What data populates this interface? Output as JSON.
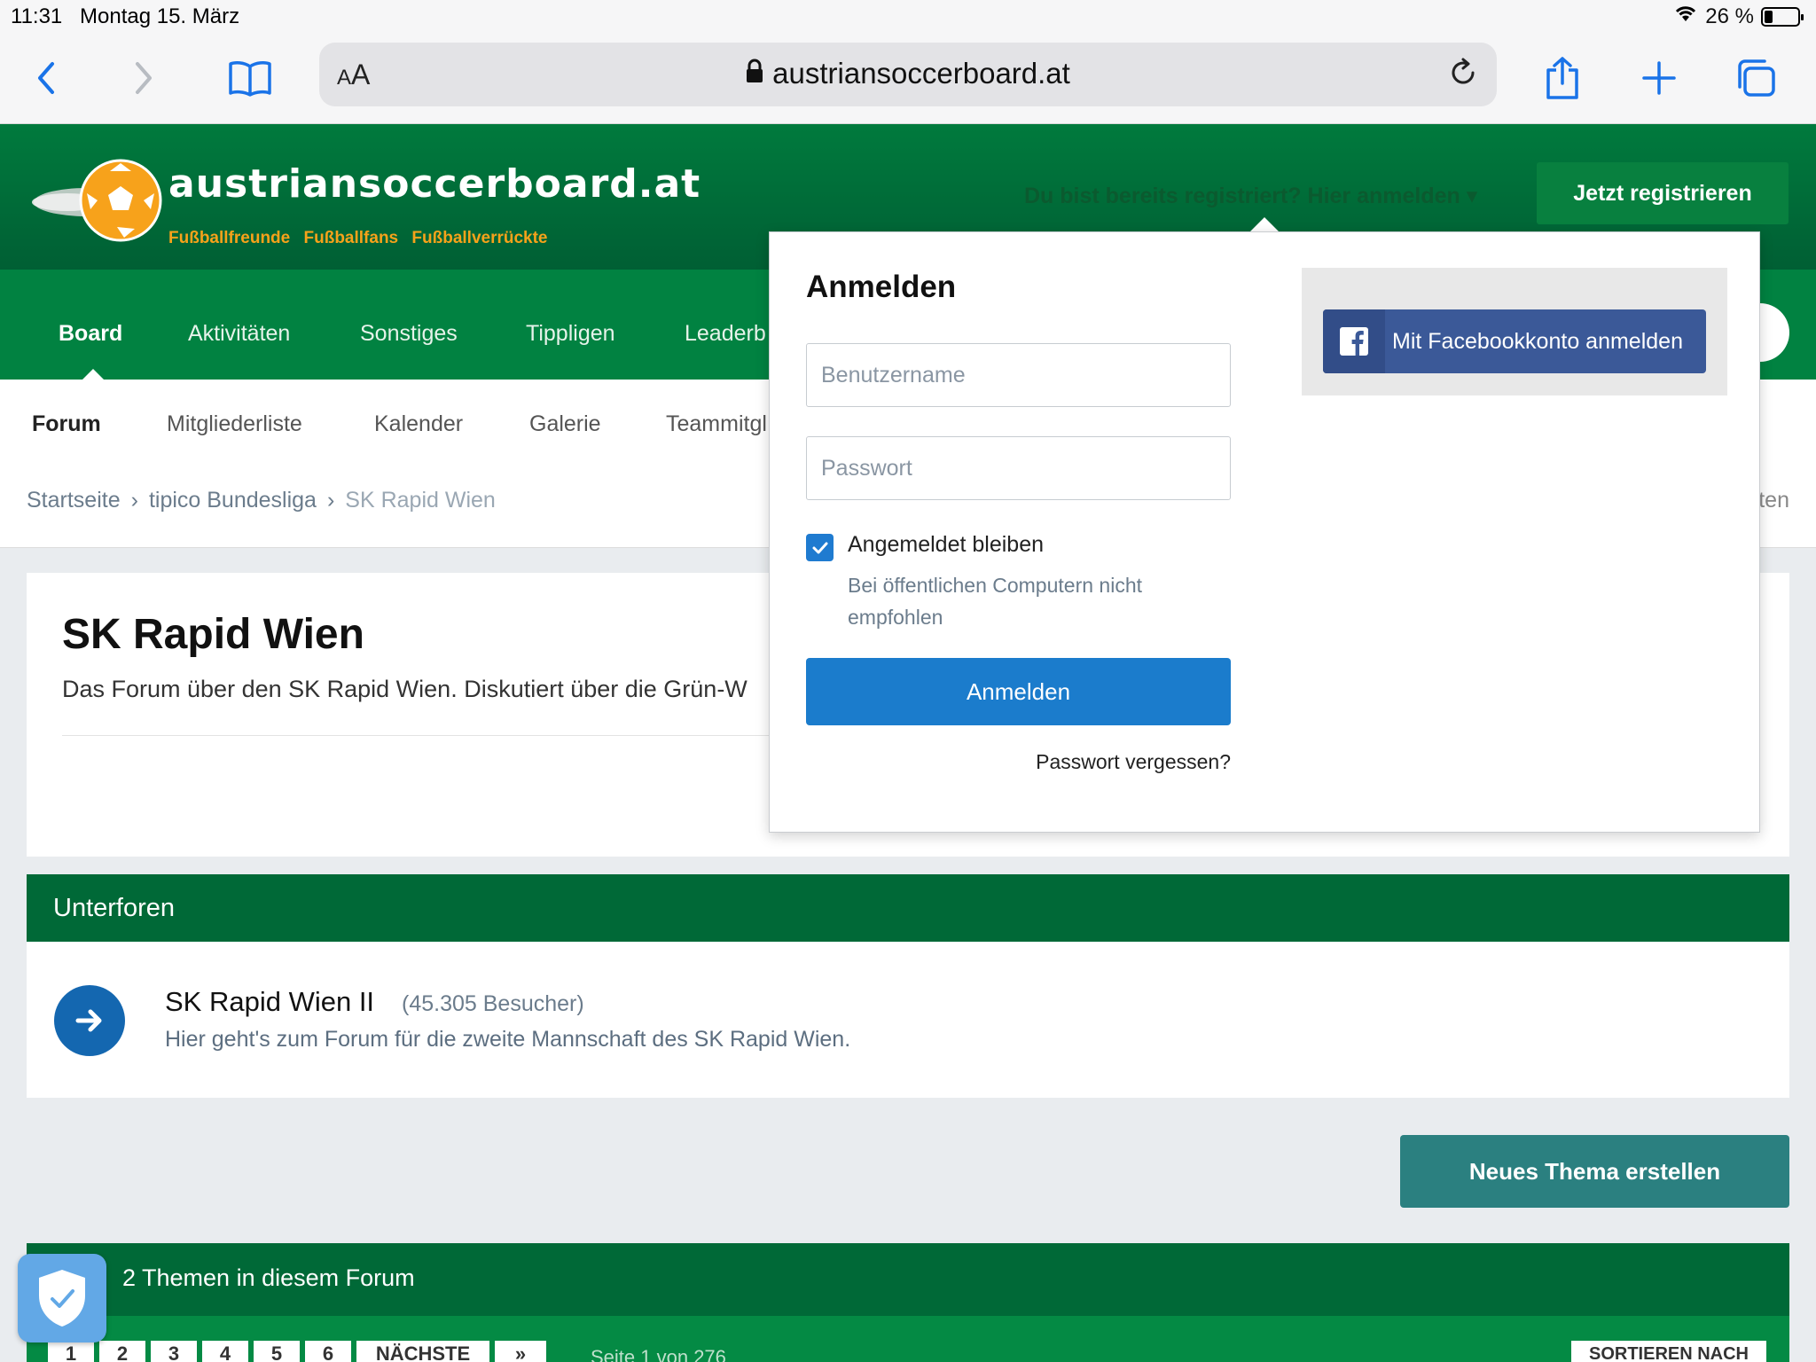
{
  "status": {
    "time": "11:31",
    "date": "Montag 15. März",
    "battery": "26 %"
  },
  "browser": {
    "aa_small": "A",
    "aa_large": "A",
    "url": "austriansoccerboard.at"
  },
  "header": {
    "logo_text": "austriansoccerboard.at",
    "tagline": "Fußballfreunde Fußballfans Fußballverrückte",
    "signin_link": "Du bist bereits registriert? Hier anmelden",
    "register_button": "Jetzt registrieren"
  },
  "nav": {
    "items": [
      "Board",
      "Aktivitäten",
      "Sonstiges",
      "Tippligen",
      "Leaderb"
    ]
  },
  "subnav": {
    "items": [
      "Forum",
      "Mitgliederliste",
      "Kalender",
      "Galerie",
      "Teammitgl"
    ]
  },
  "breadcrumb": {
    "items": [
      "Startseite",
      "tipico Bundesliga",
      "SK Rapid Wien"
    ],
    "separator": "›",
    "right_fragment": "ten"
  },
  "page": {
    "title": "SK Rapid Wien",
    "description": "Das Forum über den SK Rapid Wien. Diskutiert über die Grün-W"
  },
  "subforums": {
    "heading": "Unterforen",
    "items": [
      {
        "name": "SK Rapid Wien II",
        "visits": "(45.305 Besucher)",
        "description": "Hier geht's zum Forum für die zweite Mannschaft des SK Rapid Wien."
      }
    ]
  },
  "new_topic_button": "Neues Thema erstellen",
  "topics": {
    "heading": "2 Themen in diesem Forum",
    "pages": [
      "1",
      "2",
      "3",
      "4",
      "5",
      "6"
    ],
    "next": "NÄCHSTE",
    "last": "»",
    "page_info": "Seite 1 von 276",
    "sort": "SORTIEREN NACH"
  },
  "login": {
    "title": "Anmelden",
    "username_placeholder": "Benutzername",
    "password_placeholder": "Passwort",
    "remember_label": "Angemeldet bleiben",
    "remember_note": "Bei öffentlichen Computern nicht empfohlen",
    "submit": "Anmelden",
    "forgot": "Passwort vergessen?",
    "facebook": "Mit Facebookkonto anmelden"
  },
  "colors": {
    "brand_green": "#006937",
    "nav_green": "#018241",
    "primary_blue": "#1b7ccc",
    "teal": "#2b8080",
    "facebook": "#3b5998"
  }
}
